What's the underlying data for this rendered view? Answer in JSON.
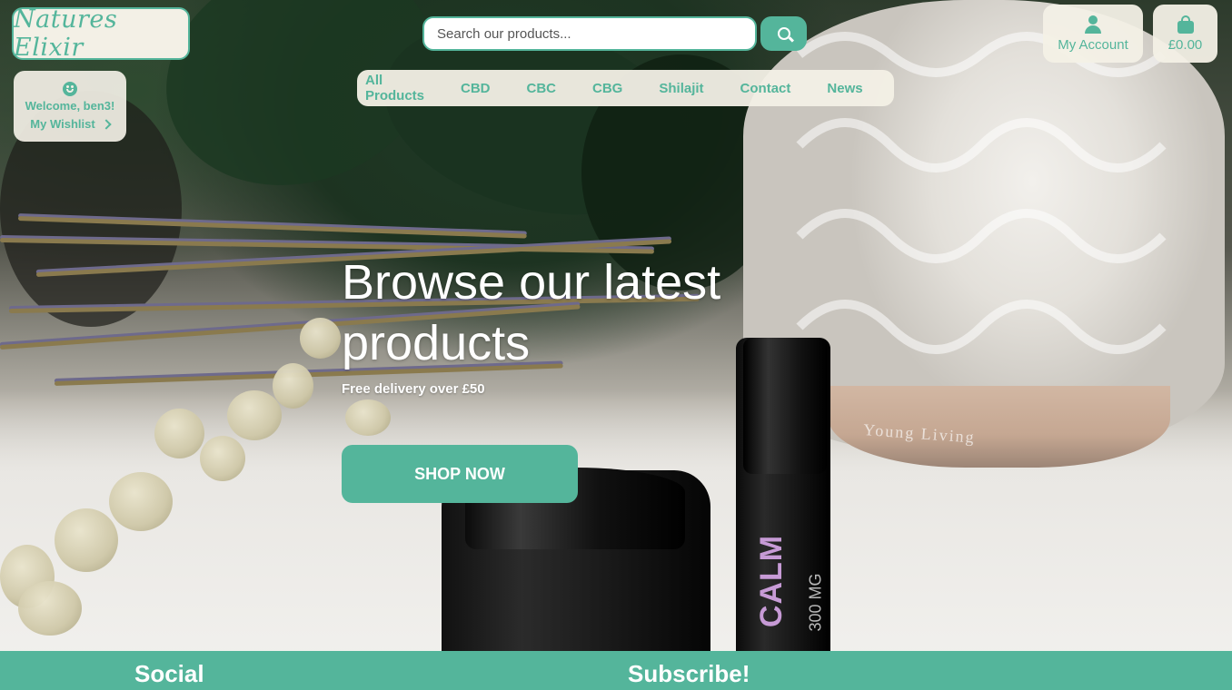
{
  "brand": {
    "logo_text": "Natures Elixir",
    "accent_color": "#54b59b",
    "cream_color": "#f3f0e6"
  },
  "welcome": {
    "icon": "smile-icon",
    "greeting": "Welcome, ben3!",
    "wishlist_label": "My Wishlist",
    "wishlist_icon": "chevron-right-icon"
  },
  "search": {
    "placeholder": "Search our products...",
    "button_icon": "search-icon"
  },
  "nav": {
    "items": [
      "All Products",
      "CBD",
      "CBC",
      "CBG",
      "Shilajit",
      "Contact",
      "News"
    ]
  },
  "account": {
    "label": "My Account",
    "icon": "user-icon"
  },
  "bag": {
    "total": "£0.00",
    "icon": "shopping-bag-icon"
  },
  "hero": {
    "title": "Browse our latest products",
    "subtitle": "Free delivery over £50",
    "cta_label": "SHOP NOW"
  },
  "product_photo": {
    "brand_mark": "Young Living",
    "roller_name": "CALM",
    "roller_strength": "300 MG"
  },
  "footer": {
    "social_heading": "Social",
    "subscribe_heading": "Subscribe!"
  }
}
